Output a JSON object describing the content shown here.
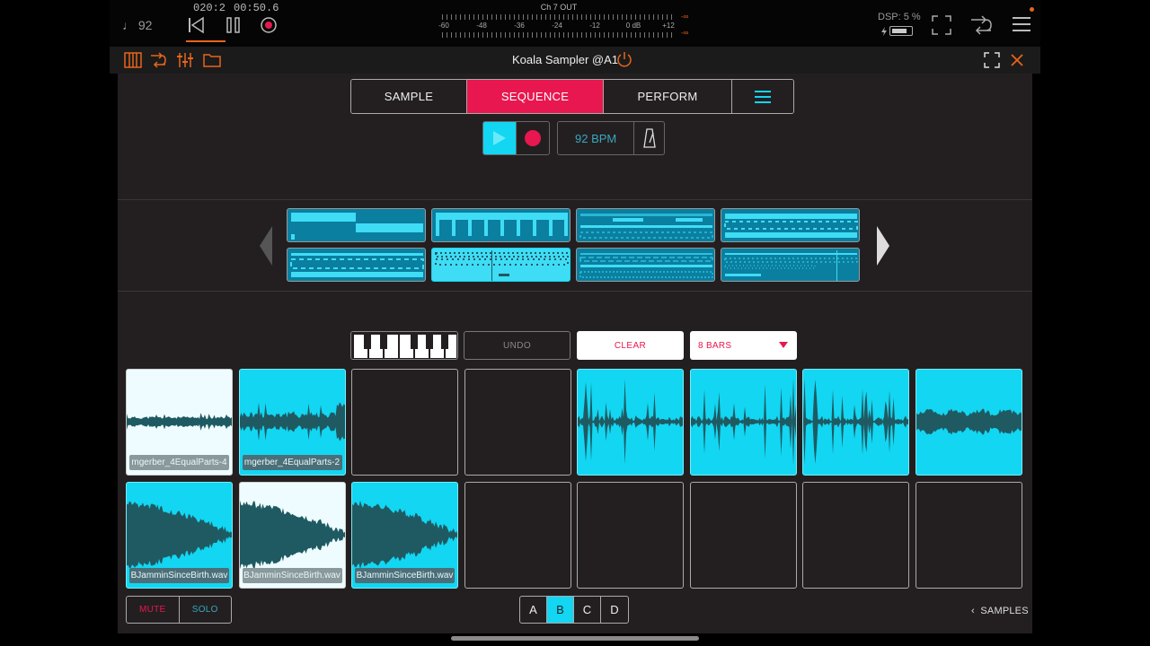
{
  "host": {
    "tempo": "♩ 92",
    "bar_position": "020:2",
    "time_position": "00:50.6",
    "meter_title": "Ch 7 OUT",
    "meter_scale": [
      "-60",
      "-48",
      "-36",
      "-24",
      "-12",
      "0 dB",
      "+12"
    ],
    "meter_peak_top": "-∞",
    "meter_peak_bottom": "-∞",
    "dsp": "DSP:  5 %"
  },
  "plugin": {
    "title": "Koala Sampler @A1"
  },
  "tabs": [
    {
      "label": "SAMPLE",
      "active": false
    },
    {
      "label": "SEQUENCE",
      "active": true
    },
    {
      "label": "PERFORM",
      "active": false
    }
  ],
  "transport": {
    "bpm": "92 BPM"
  },
  "patterns": {
    "count": 8,
    "selected_index": 5
  },
  "toolbar": {
    "undo": "UNDO",
    "clear": "CLEAR",
    "bars": "8 BARS"
  },
  "pads": [
    {
      "state": "white",
      "label": "mgerber_4EqualParts-4",
      "wave": "thin"
    },
    {
      "state": "cyan",
      "label": "mgerber_4EqualParts-2",
      "wave": "medium"
    },
    {
      "state": "empty",
      "label": ""
    },
    {
      "state": "empty",
      "label": ""
    },
    {
      "state": "cyan",
      "label": "",
      "wave": "spiky"
    },
    {
      "state": "cyan",
      "label": "",
      "wave": "spiky"
    },
    {
      "state": "cyan",
      "label": "",
      "wave": "spiky"
    },
    {
      "state": "cyan",
      "label": "",
      "wave": "blob"
    },
    {
      "state": "cyan",
      "label": "BJamminSinceBirth.wav",
      "wave": "decay"
    },
    {
      "state": "white",
      "label": "BJamminSinceBirth.wav",
      "wave": "decay"
    },
    {
      "state": "cyan",
      "label": "BJamminSinceBirth.wav",
      "wave": "decay"
    },
    {
      "state": "empty",
      "label": ""
    },
    {
      "state": "empty",
      "label": ""
    },
    {
      "state": "empty",
      "label": ""
    },
    {
      "state": "empty",
      "label": ""
    },
    {
      "state": "empty",
      "label": ""
    }
  ],
  "bottom": {
    "mute": "MUTE",
    "solo": "SOLO",
    "banks": [
      {
        "label": "A",
        "active": false
      },
      {
        "label": "B",
        "active": true
      },
      {
        "label": "C",
        "active": false
      },
      {
        "label": "D",
        "active": false
      }
    ],
    "samples": "SAMPLES"
  },
  "colors": {
    "accent_cyan": "#12d6f2",
    "accent_pink": "#e8174f",
    "waveform": "#1f5a62",
    "panel": "#231f20"
  }
}
